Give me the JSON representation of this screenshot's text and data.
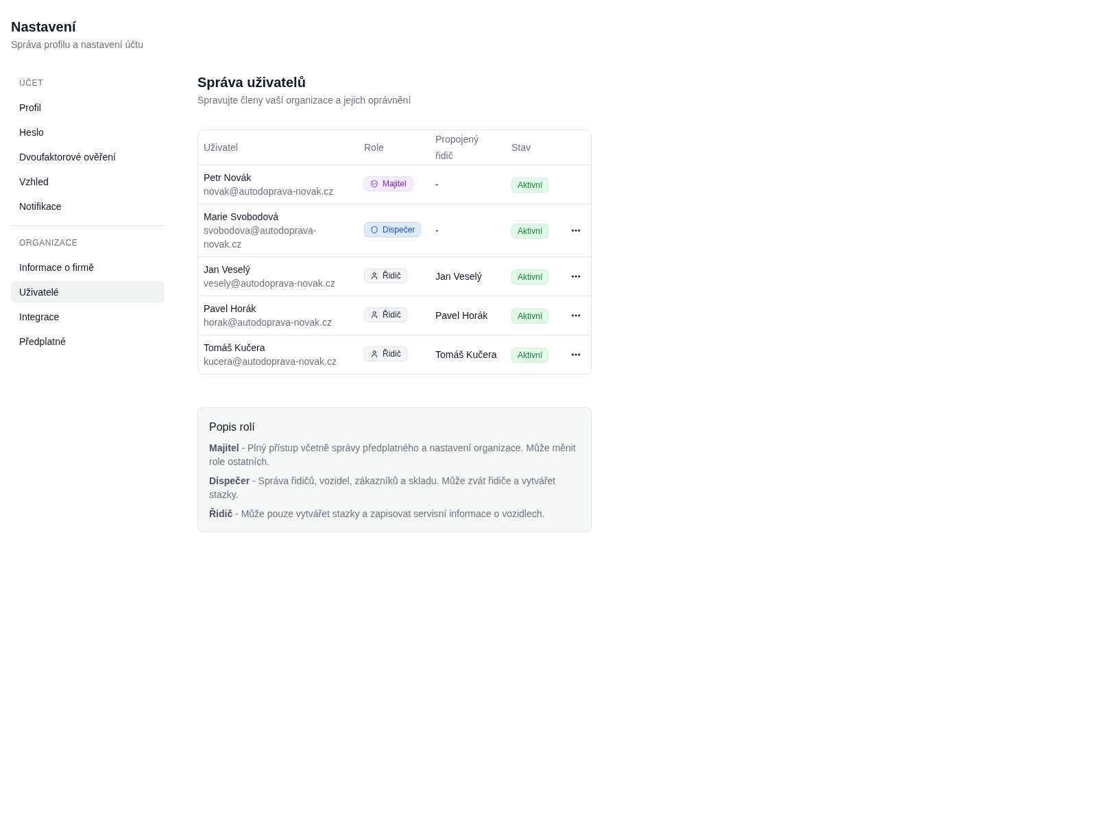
{
  "header": {
    "title": "Nastavení",
    "subtitle": "Správa profilu a nastavení účtu"
  },
  "sidebar": {
    "sections": [
      {
        "label": "ÚČET",
        "items": [
          {
            "label": "Profil",
            "selected": false
          },
          {
            "label": "Heslo",
            "selected": false
          },
          {
            "label": "Dvoufaktorové ověření",
            "selected": false
          },
          {
            "label": "Vzhled",
            "selected": false
          },
          {
            "label": "Notifikace",
            "selected": false
          }
        ]
      },
      {
        "label": "ORGANIZACE",
        "items": [
          {
            "label": "Informace o firmě",
            "selected": false
          },
          {
            "label": "Uživatelé",
            "selected": true
          },
          {
            "label": "Integrace",
            "selected": false
          },
          {
            "label": "Předplatné",
            "selected": false
          }
        ]
      }
    ]
  },
  "main": {
    "title": "Správa uživatelů",
    "subtitle": "Spravujte členy vaší organizace a jejich oprávnění",
    "table": {
      "columns": [
        "Uživatel",
        "Role",
        "Propojený řidič",
        "Stav"
      ],
      "rows": [
        {
          "name": "Petr Novák",
          "email": "novak@autodoprava-novak.cz",
          "role": {
            "label": "Majitel",
            "kind": "owner"
          },
          "linked_driver": "-",
          "status": {
            "label": "Aktivní",
            "kind": "active"
          },
          "menu": false
        },
        {
          "name": "Marie Svobodová",
          "email": "svobodova@autodoprava-novak.cz",
          "role": {
            "label": "Dispečer",
            "kind": "dispatcher"
          },
          "linked_driver": "-",
          "status": {
            "label": "Aktivní",
            "kind": "active"
          },
          "menu": true
        },
        {
          "name": "Jan Veselý",
          "email": "vesely@autodoprava-novak.cz",
          "role": {
            "label": "Řidič",
            "kind": "driver"
          },
          "linked_driver": "Jan Veselý",
          "status": {
            "label": "Aktivní",
            "kind": "active"
          },
          "menu": true
        },
        {
          "name": "Pavel Horák",
          "email": "horak@autodoprava-novak.cz",
          "role": {
            "label": "Řidič",
            "kind": "driver"
          },
          "linked_driver": "Pavel Horák",
          "status": {
            "label": "Aktivní",
            "kind": "active"
          },
          "menu": true
        },
        {
          "name": "Tomáš Kučera",
          "email": "kucera@autodoprava-novak.cz",
          "role": {
            "label": "Řidič",
            "kind": "driver"
          },
          "linked_driver": "Tomáš Kučera",
          "status": {
            "label": "Aktivní",
            "kind": "active"
          },
          "menu": true
        }
      ]
    },
    "role_descriptions": {
      "title": "Popis rolí",
      "items": [
        "**Majitel** - Plný přístup včetně správy předplatného a nastavení organizace. Může měnit role ostatních.",
        "**Dispečer** - Správa řidičů, vozidel, zákazníků a skladu. Může zvát řidiče a vytvářet stazky.",
        "**Řidič** - Může pouze vytvářet stazky a zapisovat servisní informace o vozidlech."
      ]
    }
  }
}
